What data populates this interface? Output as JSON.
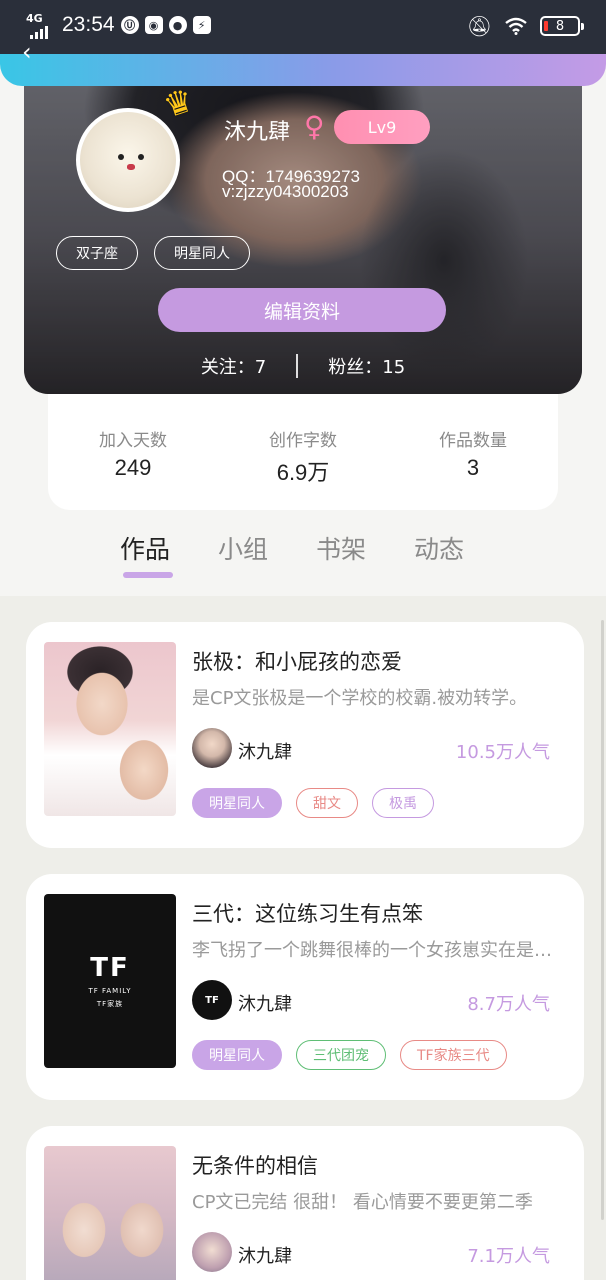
{
  "status_bar": {
    "network": "4G",
    "time": "23:54",
    "battery": "8"
  },
  "profile": {
    "username": "沐九肆",
    "gender_icon": "♀",
    "level": "Lv9",
    "qq": "QQ：1749639273",
    "wechat": "v:zjzzy04300203",
    "tags": [
      "双子座",
      "明星同人"
    ],
    "edit_button": "编辑资料",
    "follow": "关注：7",
    "fans": "粉丝：15"
  },
  "stats": [
    {
      "label": "加入天数",
      "value": "249"
    },
    {
      "label": "创作字数",
      "value": "6.9万"
    },
    {
      "label": "作品数量",
      "value": "3"
    }
  ],
  "tabs": [
    "作品",
    "小组",
    "书架",
    "动态"
  ],
  "active_tab": "作品",
  "works": [
    {
      "title": "张极：和小屁孩的恋爱",
      "desc": "是CP文张极是一个学校的校霸.被劝转学。",
      "author": "沐九肆",
      "popularity": "10.5万人气",
      "tags": [
        {
          "text": "明星同人",
          "style": "filled"
        },
        {
          "text": "甜文",
          "style": "red"
        },
        {
          "text": "极禹",
          "style": "purple"
        }
      ]
    },
    {
      "title": "三代：这位练习生有点笨",
      "desc": "李飞拐了一个跳舞很棒的一个女孩崽实在是太可爱",
      "author": "沐九肆",
      "popularity": "8.7万人气",
      "cover_text": "TF",
      "cover_caption": "TF FAMILY",
      "cover_caption2": "TF家族",
      "tags": [
        {
          "text": "明星同人",
          "style": "filled"
        },
        {
          "text": "三代团宠",
          "style": "green"
        },
        {
          "text": "TF家族三代",
          "style": "red"
        }
      ]
    },
    {
      "title": "无条件的相信",
      "desc": "CP文已完结 很甜！ 看心情要不要更第二季",
      "author": "沐九肆",
      "popularity": "7.1万人气",
      "tags": []
    }
  ]
}
